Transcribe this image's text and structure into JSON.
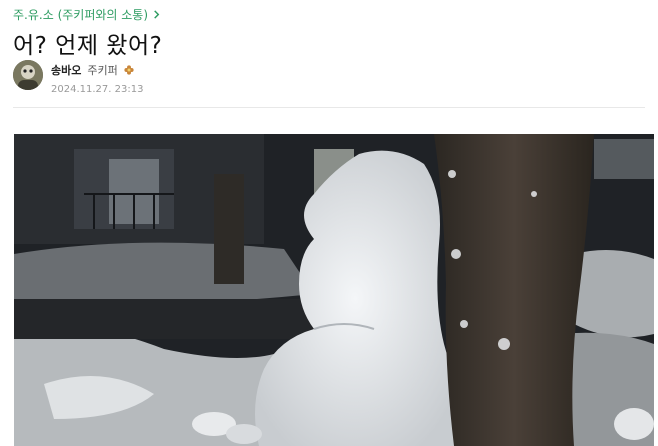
{
  "board": {
    "name": "주.유.소 (주키퍼와의 소통)",
    "icon": "chevron-right-icon"
  },
  "post": {
    "title": "어? 언제 왔어?",
    "author": {
      "nickname": "송바오",
      "grade": "주키퍼",
      "grade_icon": "flower-badge-icon"
    },
    "date": "2024.11.27. 23:13"
  },
  "colors": {
    "accent": "#2e9c62",
    "badge": "#c9853a"
  }
}
